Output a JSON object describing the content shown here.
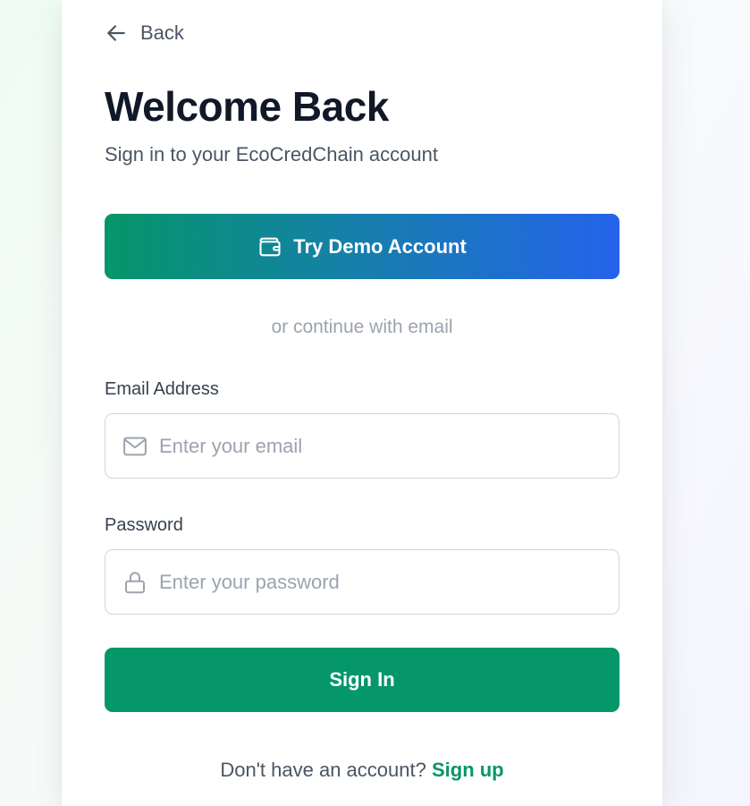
{
  "header": {
    "back_label": "Back",
    "title": "Welcome Back",
    "subtitle": "Sign in to your EcoCredChain account"
  },
  "demo": {
    "label": "Try Demo Account",
    "icon": "wallet-icon"
  },
  "divider": {
    "text": "or continue with email"
  },
  "form": {
    "email": {
      "label": "Email Address",
      "placeholder": "Enter your email",
      "value": "",
      "icon": "mail-icon"
    },
    "password": {
      "label": "Password",
      "placeholder": "Enter your password",
      "value": "",
      "icon": "lock-icon"
    },
    "submit_label": "Sign In"
  },
  "footer": {
    "prompt": "Don't have an account?",
    "link_label": "Sign up"
  },
  "colors": {
    "primary": "#059669",
    "gradient_start": "#059669",
    "gradient_end": "#2563eb",
    "title": "#111827",
    "muted": "#9ca3af"
  }
}
